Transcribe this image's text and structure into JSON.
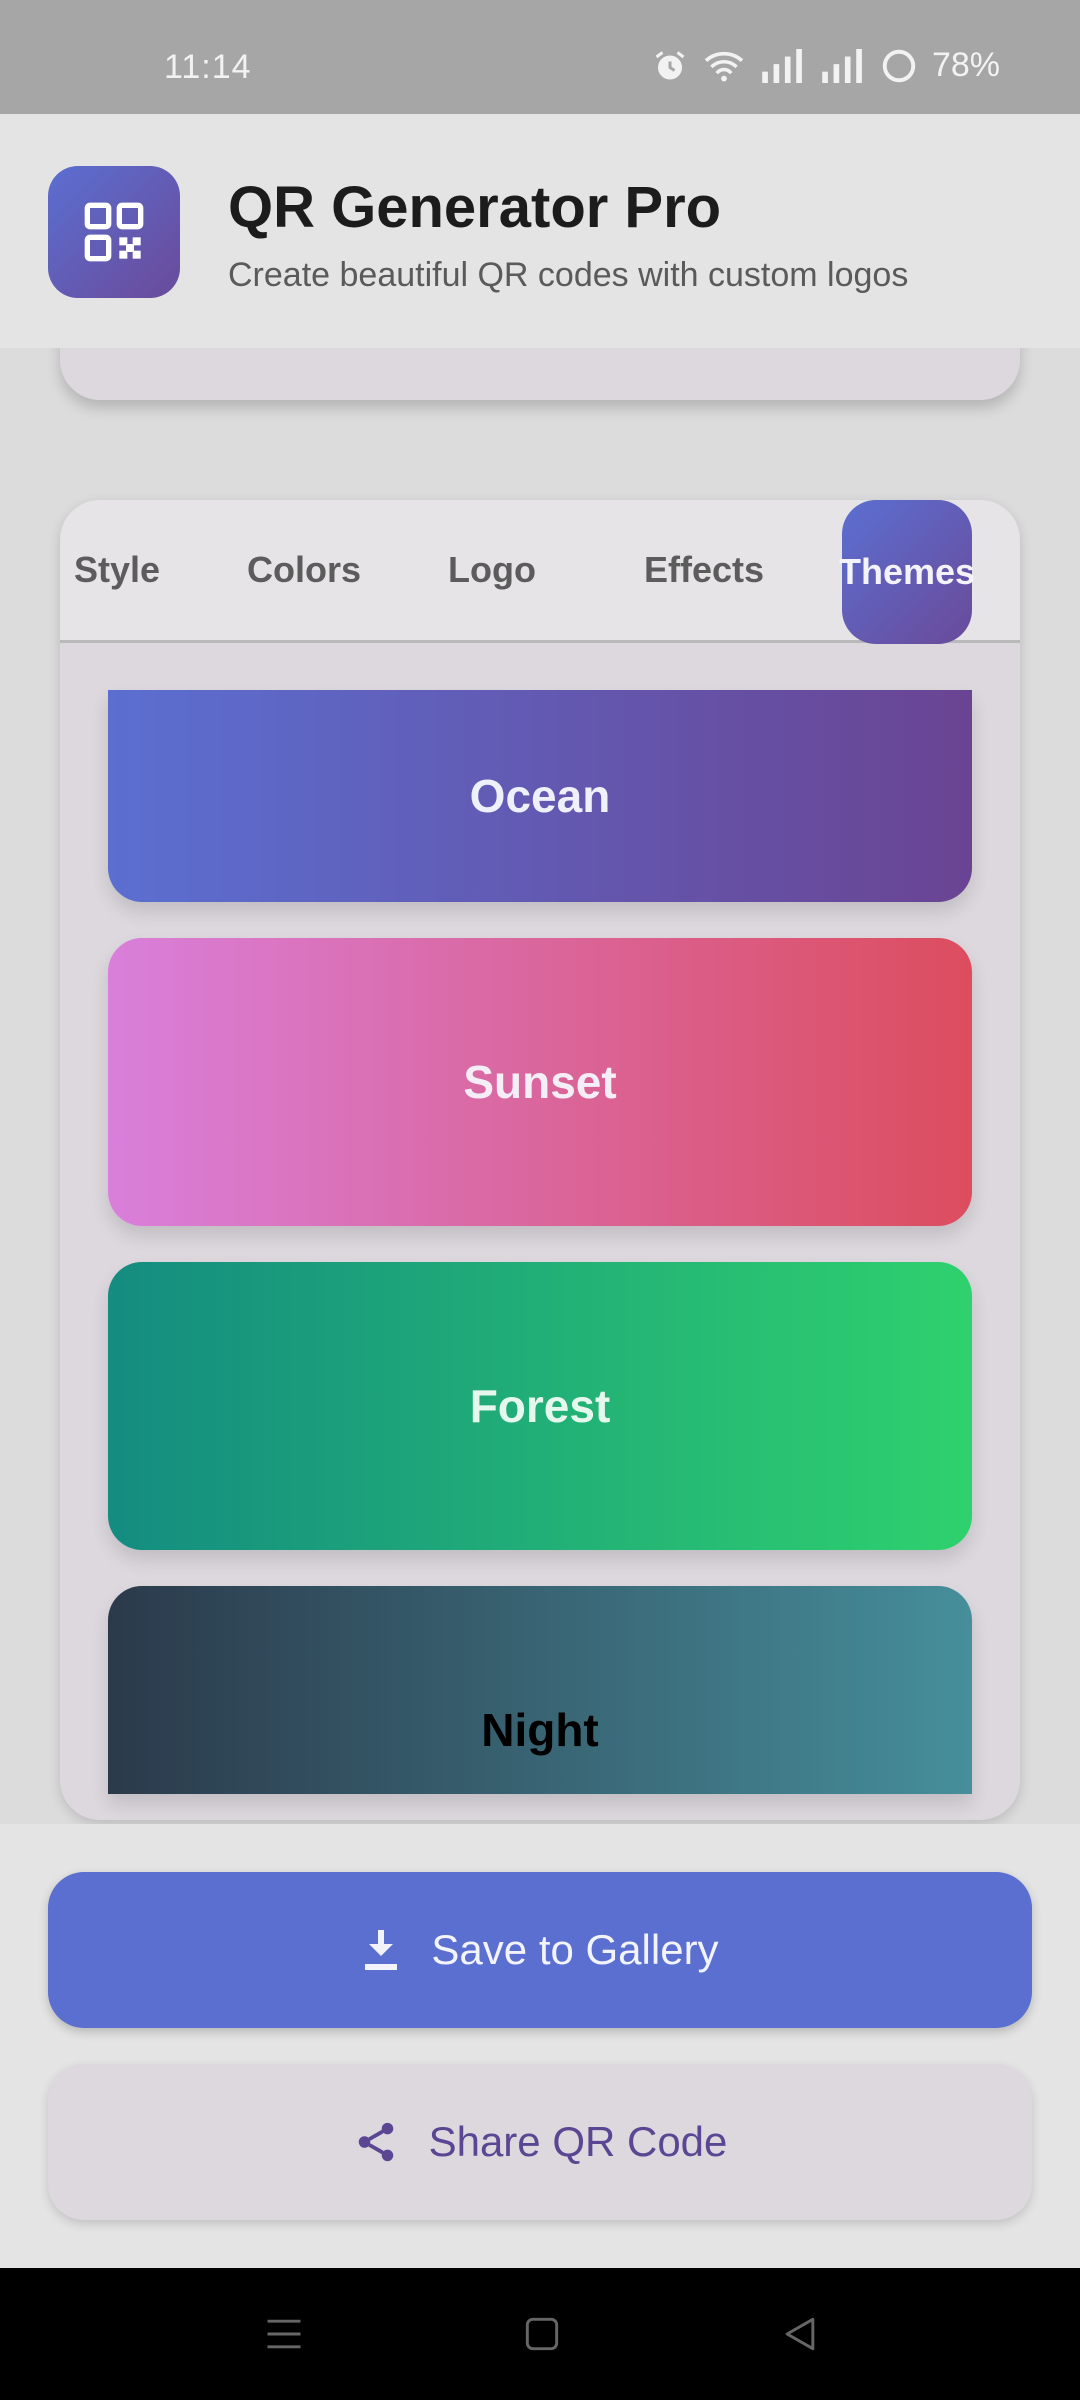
{
  "status_bar": {
    "time": "11:14",
    "battery": "78%",
    "icons": [
      "alarm-icon",
      "wifi-icon",
      "signal-icon",
      "signal-icon",
      "battery-icon"
    ]
  },
  "header": {
    "title": "QR Generator Pro",
    "subtitle": "Create beautiful QR codes with custom logos",
    "icon": "qr-code-icon"
  },
  "tabs": [
    {
      "label": "Style",
      "active": false
    },
    {
      "label": "Colors",
      "active": false
    },
    {
      "label": "Logo",
      "active": false
    },
    {
      "label": "Effects",
      "active": false
    },
    {
      "label": "Themes",
      "active": true
    }
  ],
  "themes": [
    {
      "name": "Ocean",
      "from": "#5b6fd1",
      "to": "#6a4493",
      "text": "#eef0fa"
    },
    {
      "name": "Sunset",
      "from": "#d97fdb",
      "to": "#dc4d5e",
      "text": "#f6eef6"
    },
    {
      "name": "Forest",
      "from": "#148c80",
      "to": "#2fd16e",
      "text": "#e6f7ee"
    },
    {
      "name": "Night",
      "from": "#2b3a4b",
      "to": "#468e9b",
      "text": "#000000"
    }
  ],
  "actions": {
    "save_label": "Save to Gallery",
    "share_label": "Share QR Code"
  },
  "colors": {
    "primary": "#5b6fd1",
    "primary_dark": "#6a4a99",
    "share_text": "#5a4693"
  }
}
